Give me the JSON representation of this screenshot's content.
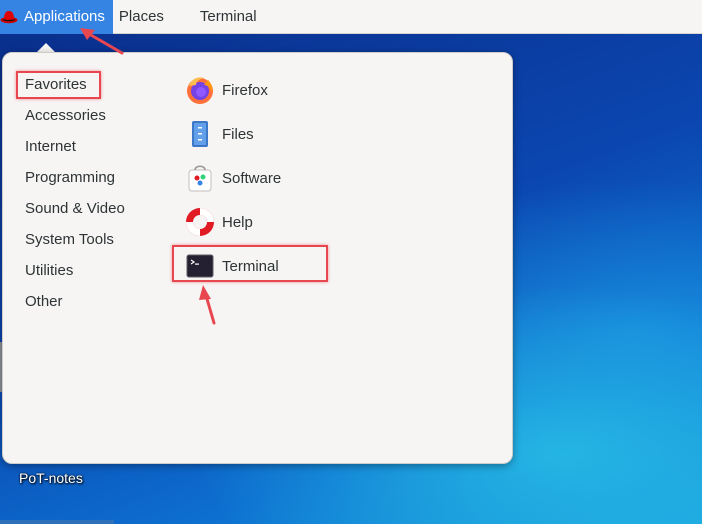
{
  "topbar": {
    "applications_label": "Applications",
    "places_label": "Places",
    "terminal_label": "Terminal"
  },
  "menu": {
    "categories": [
      {
        "label": "Favorites",
        "selected": true
      },
      {
        "label": "Accessories"
      },
      {
        "label": "Internet"
      },
      {
        "label": "Programming"
      },
      {
        "label": "Sound & Video"
      },
      {
        "label": "System Tools"
      },
      {
        "label": "Utilities"
      },
      {
        "label": "Other"
      }
    ],
    "apps": [
      {
        "label": "Firefox",
        "icon": "firefox-icon"
      },
      {
        "label": "Files",
        "icon": "files-icon"
      },
      {
        "label": "Software",
        "icon": "software-icon"
      },
      {
        "label": "Help",
        "icon": "help-icon"
      },
      {
        "label": "Terminal",
        "icon": "terminal-icon"
      }
    ]
  },
  "desktop": {
    "icon_label": "PoT-notes"
  },
  "colors": {
    "accent": "#3584e4",
    "highlight": "#e8474f"
  }
}
